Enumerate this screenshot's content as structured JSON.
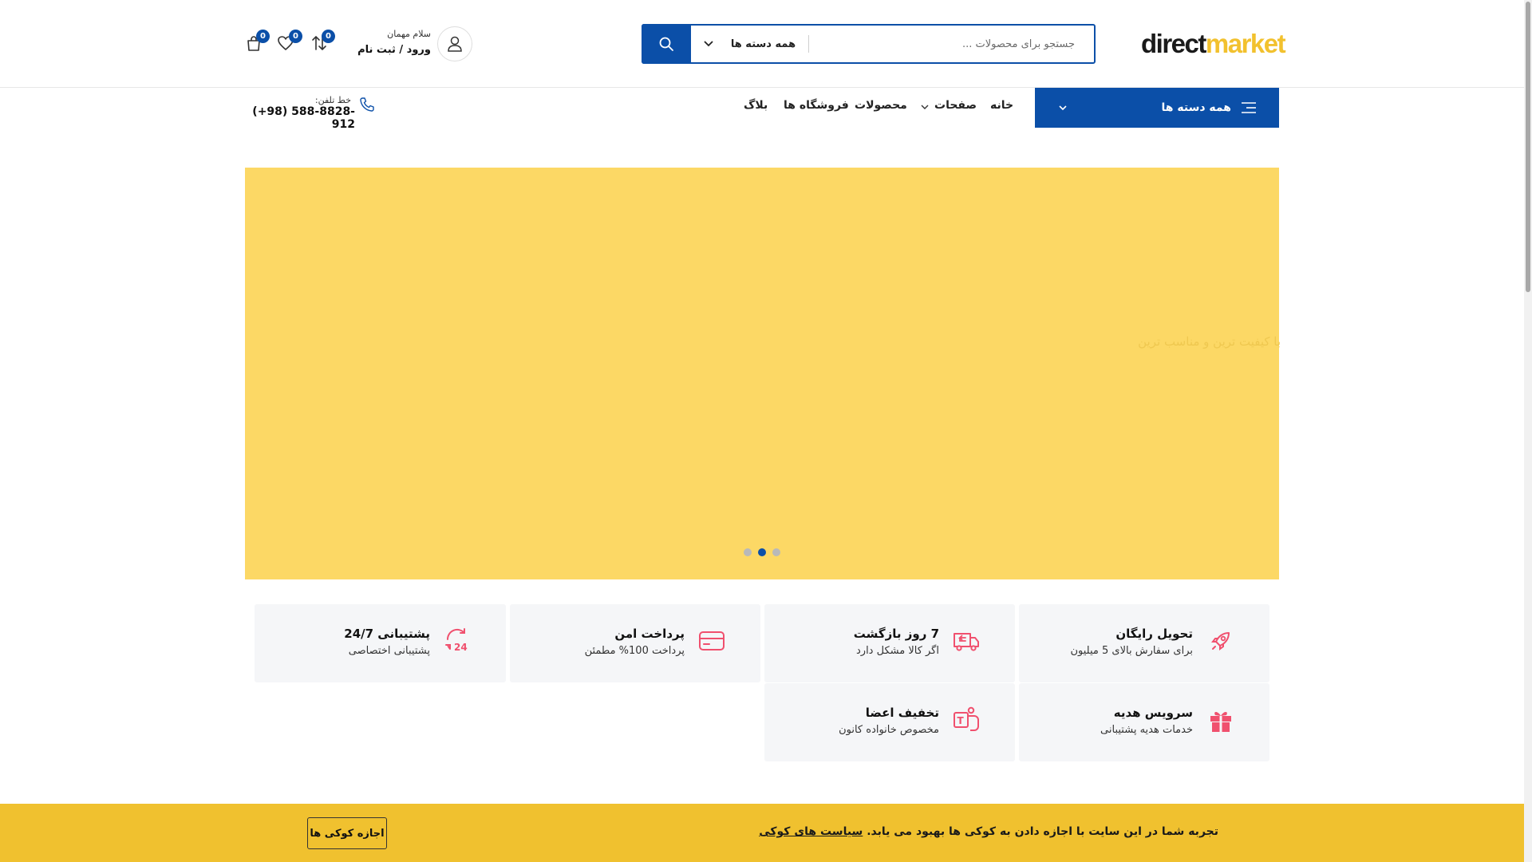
{
  "header": {
    "logo_part1": "direct",
    "logo_part2": "market",
    "search_placeholder": "جستجو برای محصولات ...",
    "search_category": "همه دسته ها",
    "greeting": "سلام مهمان",
    "login_label": "ورود / ثبت نام",
    "compare_count": "0",
    "wishlist_count": "0",
    "cart_count": "0"
  },
  "nav": {
    "all_categories": "همه دسته ها",
    "links": [
      "خانه",
      "صفحات",
      "محصولات",
      "فروشگاه ها",
      "بلاگ"
    ],
    "phone_label": "خط تلفن:",
    "phone_number": "(+98) 588-8828-912"
  },
  "hero": {
    "tagline": "با کیفیت ترین و مناسب ترین",
    "slides": 3,
    "active_slide": 2,
    "background": "#fcd865"
  },
  "features": [
    {
      "title": "تحویل رایگان",
      "subtitle": "برای سفارش بالای 5 میلیون",
      "icon": "rocket-icon"
    },
    {
      "title": "7 روز بازگشت",
      "subtitle": "اگر کالا مشکل دارد",
      "icon": "truck-return-icon"
    },
    {
      "title": "پرداخت امن",
      "subtitle": "پرداخت 100% مطمئن",
      "icon": "credit-card-icon"
    },
    {
      "title": "پشتیبانی 24/7",
      "subtitle": "پشتیبانی اختصاصی",
      "icon": "support-24-icon"
    },
    {
      "title": "سرویس هدیه",
      "subtitle": "خدمات هدیه پشتیبانی",
      "icon": "gift-icon"
    },
    {
      "title": "تخفیف اعضا",
      "subtitle": "مخصوص خانواده کانون",
      "icon": "member-discount-icon"
    }
  ],
  "cookie": {
    "text": "تجربه شما در این سایت با اجازه دادن به کوکی ها بهبود می یابد.",
    "link": "سیاست های کوکی",
    "button": "اجازه کوکی ها"
  },
  "colors": {
    "primary": "#0b4fa8",
    "accent_icon": "#f0506e",
    "cookie_bar": "#f0c12f"
  }
}
